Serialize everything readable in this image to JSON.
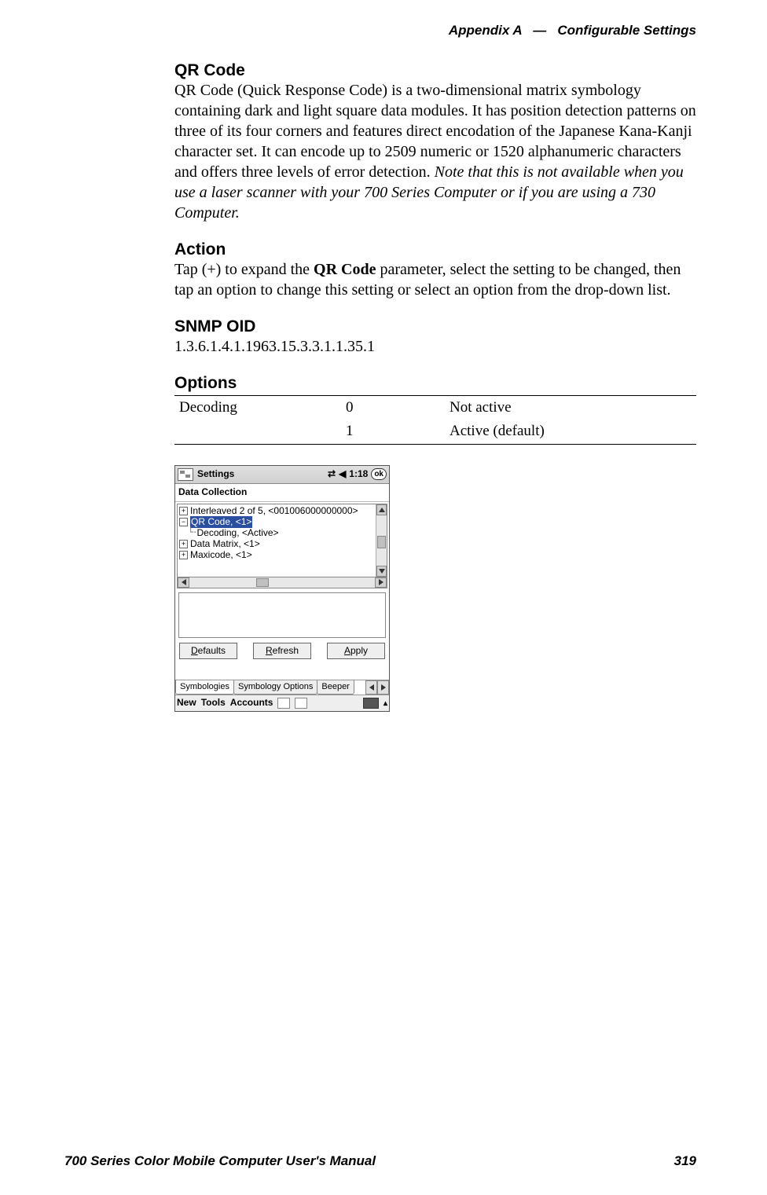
{
  "header": {
    "appendix": "Appendix A",
    "sep": "—",
    "title": "Configurable Settings"
  },
  "sections": {
    "qrcode": {
      "heading": "QR Code",
      "body": "QR Code (Quick Response Code) is a two-dimensional matrix symbology containing dark and light square data modules. It has position detection patterns on three of its four corners and features direct encodation of the Japanese Kana-Kanji character set. It can encode up to 2509 numeric or 1520 alphanumeric characters and offers three levels of error detection.",
      "note": "Note that this is not available when you use a laser scanner with your 700 Series Computer or if you are using a 730 Computer."
    },
    "action": {
      "heading": "Action",
      "pre": "Tap (+) to expand the ",
      "bold": "QR Code",
      "post": " parameter, select the setting to be changed, then tap an option to change this setting or select an option from the drop-down list."
    },
    "snmp": {
      "heading": "SNMP OID",
      "value": "1.3.6.1.4.1.1963.15.3.3.1.1.35.1"
    },
    "options": {
      "heading": "Options",
      "rows": [
        {
          "name": "Decoding",
          "code": "0",
          "desc": "Not active"
        },
        {
          "name": "",
          "code": "1",
          "desc": "Active (default)"
        }
      ]
    }
  },
  "screenshot": {
    "window_title": "Settings",
    "time": "1:18",
    "ok": "ok",
    "panel_title": "Data Collection",
    "tree": [
      {
        "icon": "plus",
        "indent": 0,
        "label": "Interleaved 2 of 5, <001006000000000>"
      },
      {
        "icon": "minus",
        "indent": 0,
        "label": "QR Code, <1>",
        "selected": true
      },
      {
        "icon": "none",
        "indent": 1,
        "label": "Decoding, <Active>"
      },
      {
        "icon": "plus",
        "indent": 0,
        "label": "Data Matrix, <1>"
      },
      {
        "icon": "plus",
        "indent": 0,
        "label": "Maxicode, <1>"
      }
    ],
    "buttons": {
      "defaults": "Defaults",
      "refresh": "Refresh",
      "apply": "Apply"
    },
    "tabs": [
      "Symbologies",
      "Symbology Options",
      "Beeper"
    ],
    "taskbar": [
      "New",
      "Tools",
      "Accounts"
    ]
  },
  "footer": {
    "manual": "700 Series Color Mobile Computer User's Manual",
    "page": "319"
  }
}
